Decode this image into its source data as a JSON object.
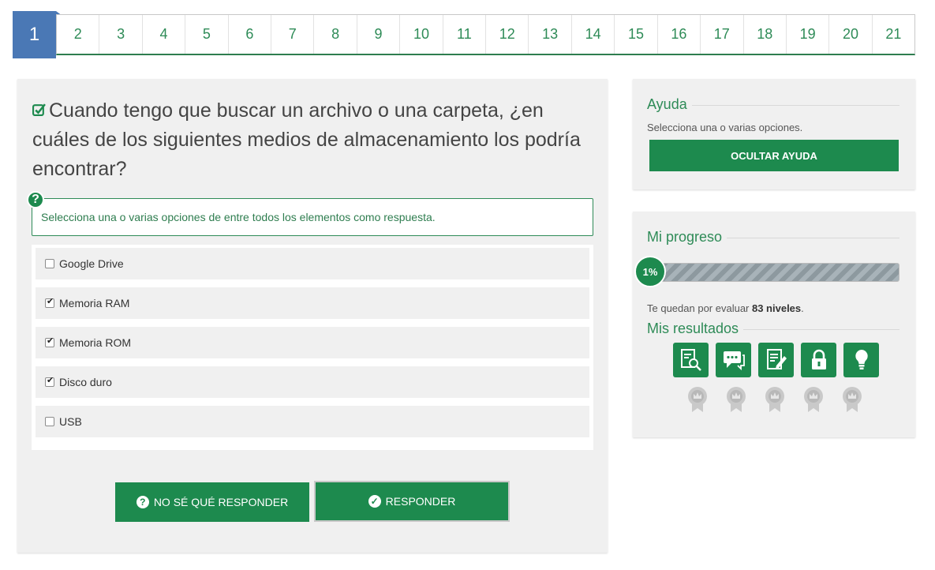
{
  "pager": {
    "active": "1",
    "items": [
      "2",
      "3",
      "4",
      "5",
      "6",
      "7",
      "8",
      "9",
      "10",
      "11",
      "12",
      "13",
      "14",
      "15",
      "16",
      "17",
      "18",
      "19",
      "20",
      "21"
    ]
  },
  "question": {
    "title": "Cuando tengo que buscar un archivo o una carpeta, ¿en cuáles de los siguientes medios de almacenamiento los podría encontrar?",
    "instruction": "Selecciona una o varias opciones de entre todos los elementos como respuesta.",
    "options": [
      {
        "label": "Google Drive",
        "checked": false
      },
      {
        "label": "Memoria RAM",
        "checked": true
      },
      {
        "label": "Memoria ROM",
        "checked": true
      },
      {
        "label": "Disco duro",
        "checked": true
      },
      {
        "label": "USB",
        "checked": false
      }
    ],
    "dont_know_label": "NO SÉ QUÉ RESPONDER",
    "answer_label": "RESPONDER"
  },
  "help_panel": {
    "title": "Ayuda",
    "text": "Selecciona una o varias opciones.",
    "button_label": "OCULTAR AYUDA"
  },
  "progress_panel": {
    "title": "Mi progreso",
    "percent_label": "1%",
    "progress_fraction": 0.01,
    "remaining_prefix": "Te quedan por evaluar ",
    "remaining_count": "83 niveles",
    "remaining_suffix": ".",
    "results_title": "Mis resultados",
    "result_icons": [
      "search-document-icon",
      "chat-icon",
      "edit-document-icon",
      "lock-icon",
      "lightbulb-icon"
    ],
    "medals": 5
  },
  "colors": {
    "accent_green": "#1d8a4e",
    "active_blue": "#4a78b5",
    "panel_bg": "#f0f0f0"
  }
}
